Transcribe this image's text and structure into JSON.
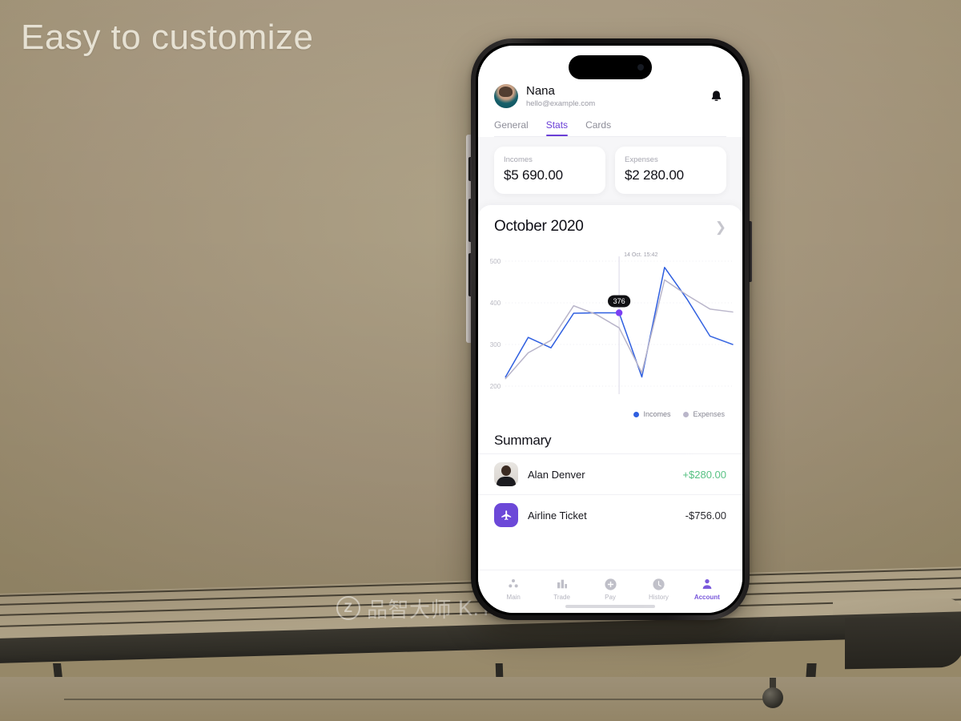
{
  "overlay": {
    "headline": "Easy to customize"
  },
  "watermark": {
    "logo": "Z",
    "brand_cn": "品智大师",
    "url": "K.TAOBAO.COM"
  },
  "phone": {
    "app": {
      "header": {
        "avatar_icon": "user-avatar",
        "user_name": "Nana",
        "user_email": "hello@example.com",
        "notification_icon": "bell-icon",
        "tabs": [
          {
            "label": "General",
            "active": false
          },
          {
            "label": "Stats",
            "active": true
          },
          {
            "label": "Cards",
            "active": false
          }
        ]
      },
      "stats": [
        {
          "label": "Incomes",
          "value": "$5 690.00"
        },
        {
          "label": "Expenses",
          "value": "$2 280.00"
        }
      ],
      "period": {
        "title": "October 2020",
        "chevron_icon": "chevron-right-icon"
      },
      "legend": [
        {
          "label": "Incomes",
          "color": "#2f5fe0"
        },
        {
          "label": "Expenses",
          "color": "#b8b4c9"
        }
      ],
      "summary": {
        "title": "Summary",
        "rows": [
          {
            "icon": "person-photo-icon",
            "name": "Alan Denver",
            "amount": "+$280.00",
            "positive": true
          },
          {
            "icon": "airplane-icon",
            "name": "Airline Ticket",
            "amount": "-$756.00",
            "positive": false
          }
        ]
      },
      "tabbar": [
        {
          "icon": "dots-grid-icon",
          "label": "Main",
          "active": false
        },
        {
          "icon": "bar-chart-icon",
          "label": "Trade",
          "active": false
        },
        {
          "icon": "plus-circle-icon",
          "label": "Pay",
          "active": false
        },
        {
          "icon": "clock-icon",
          "label": "History",
          "active": false
        },
        {
          "icon": "person-icon",
          "label": "Account",
          "active": true
        }
      ]
    }
  },
  "chart_data": {
    "type": "line",
    "title": "October 2020",
    "xlabel": "",
    "ylabel": "",
    "ylim": [
      200,
      500
    ],
    "yticks": [
      200,
      300,
      400,
      500
    ],
    "ytick_labels": [
      "200",
      "300",
      "400",
      "500"
    ],
    "grid": true,
    "legend_position": "bottom-right",
    "annotation": {
      "cursor_label": "14 Oct. 15:42",
      "tooltip_value": "376",
      "point_index": 5,
      "point_color": "#7b3ff2"
    },
    "x": [
      0,
      1,
      2,
      3,
      4,
      5,
      6,
      7,
      8,
      9,
      10
    ],
    "series": [
      {
        "name": "Incomes",
        "color": "#2f5fe0",
        "values": [
          222,
          317,
          292,
          375,
          376,
          376,
          222,
          485,
          408,
          320,
          300
        ]
      },
      {
        "name": "Expenses",
        "color": "#b8b4c9",
        "values": [
          218,
          280,
          310,
          393,
          372,
          340,
          232,
          455,
          418,
          385,
          378
        ]
      }
    ]
  }
}
